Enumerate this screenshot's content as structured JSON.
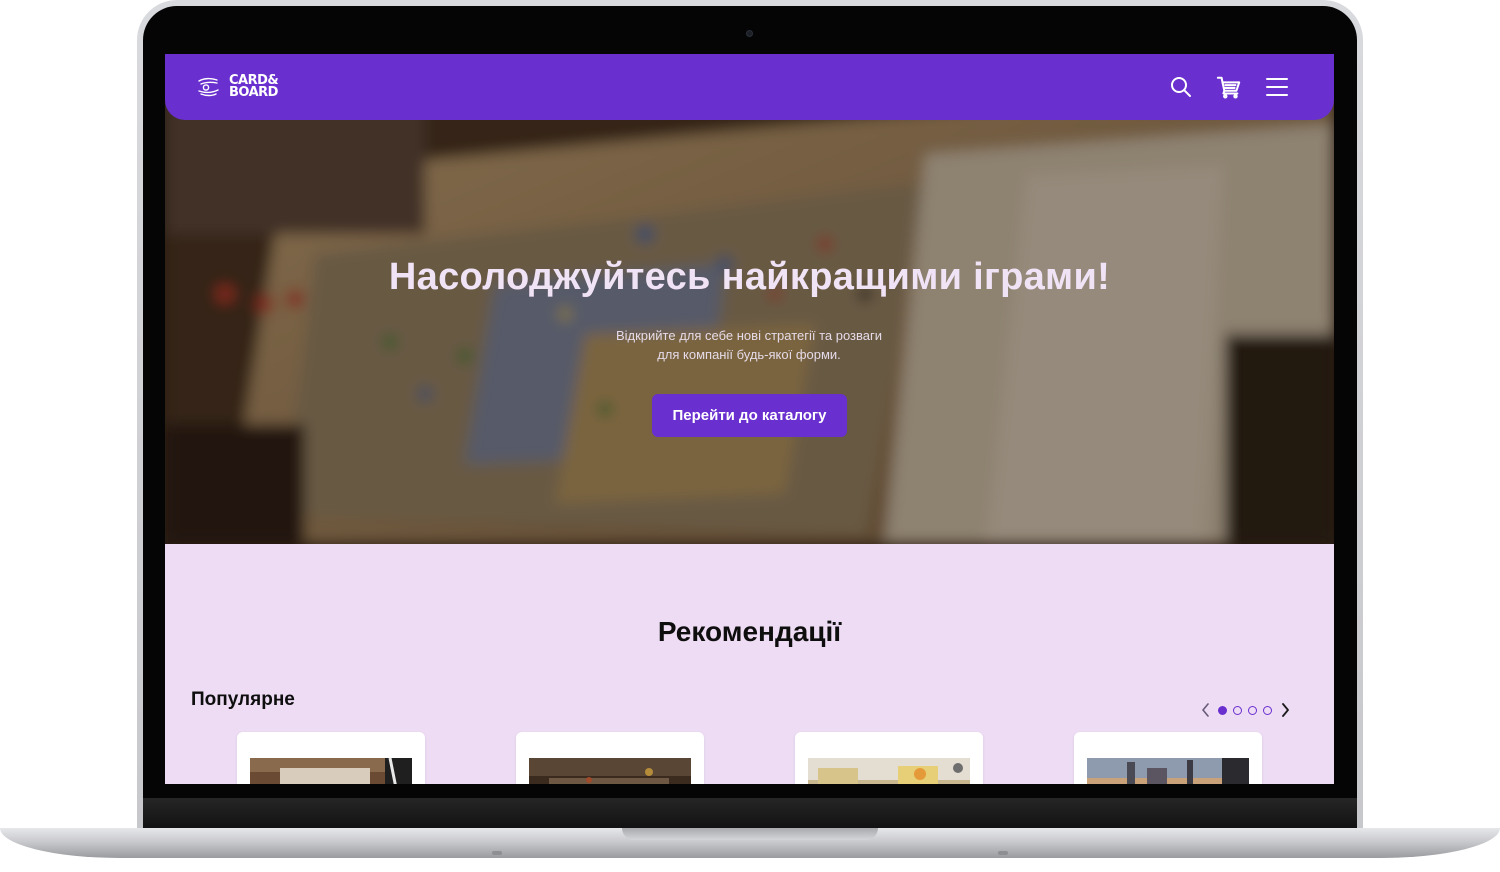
{
  "brand": {
    "logo_line1": "CARD&",
    "logo_line2": "BOARD",
    "primary_color": "#6a2fcf",
    "section_bg": "#eddcf4"
  },
  "header": {
    "icons": [
      "search-icon",
      "cart-icon",
      "menu-icon"
    ]
  },
  "hero": {
    "title": "Насолоджуйтесь найкращими іграми!",
    "subtitle_line1": "Відкрийте для себе нові стратегії та розваги",
    "subtitle_line2": "для компанії будь-якої форми.",
    "cta_label": "Перейти до каталогу"
  },
  "recommendations": {
    "title": "Рекомендації",
    "popular_title": "Популярне",
    "carousel": {
      "pages": 4,
      "active_page": 1
    },
    "cards": [
      {
        "image": "board-game-photo-1"
      },
      {
        "image": "board-game-photo-2"
      },
      {
        "image": "board-game-photo-3"
      },
      {
        "image": "board-game-photo-4"
      }
    ]
  }
}
